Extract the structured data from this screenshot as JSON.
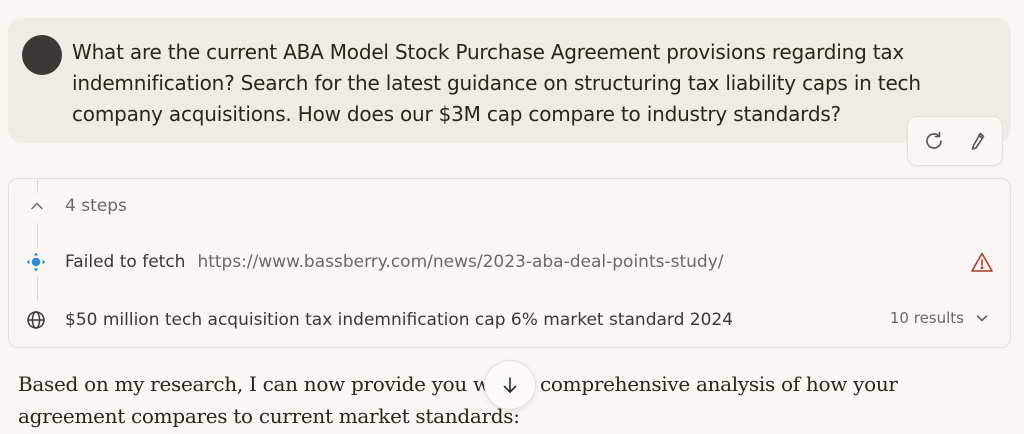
{
  "user_message": {
    "text": "What are the current ABA Model Stock Purchase Agreement provisions regarding tax indemnification? Search for the latest guidance on structuring tax liability caps in tech company acquisitions. How does our $3M cap compare to industry standards?",
    "actions": [
      {
        "icon": "retry-icon"
      },
      {
        "icon": "edit-icon"
      }
    ]
  },
  "steps": {
    "label": "4 steps",
    "expanded": true,
    "items": [
      {
        "type": "fetch",
        "icon": "fetch-icon",
        "status_label": "Failed to fetch",
        "url": "https://www.bassberry.com/news/2023-aba-deal-points-study/",
        "status_icon": "warning-icon",
        "colors": {
          "icon": "#2b8fd6",
          "warning": "#b53b2d"
        }
      },
      {
        "type": "search",
        "icon": "globe-icon",
        "query": "$50 million tech acquisition tax indemnification cap 6% market standard 2024",
        "results_label": "10 results"
      }
    ]
  },
  "answer": {
    "text": "Based on my research, I can now provide you with a comprehensive analysis of how your agreement compares to current market standards:"
  },
  "scroll_button": {
    "icon": "arrow-down-icon"
  }
}
